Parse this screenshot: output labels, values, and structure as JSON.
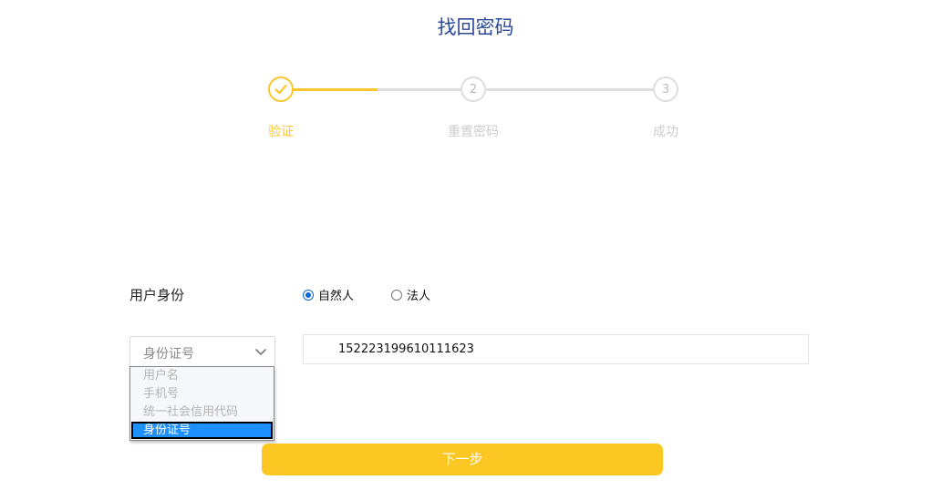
{
  "page": {
    "title": "找回密码"
  },
  "steps": [
    {
      "number": "1",
      "label": "验证",
      "status": "done"
    },
    {
      "number": "2",
      "label": "重置密码",
      "status": "pending"
    },
    {
      "number": "3",
      "label": "成功",
      "status": "pending"
    }
  ],
  "form": {
    "identity_label": "用户身份",
    "radio_options": [
      {
        "label": "自然人",
        "checked": true
      },
      {
        "label": "法人",
        "checked": false
      }
    ],
    "id_type_select": {
      "value": "身份证号",
      "options": [
        "用户名",
        "手机号",
        "统一社会信用代码",
        "身份证号"
      ],
      "selected_index": 3
    },
    "id_input": {
      "value": "152223199610111623"
    },
    "next_button_label": "下一步"
  },
  "colors": {
    "accent": "#fcc723",
    "title": "#2c4a9a",
    "inactive": "#dddddd",
    "radio": "#0a66d8",
    "dropdown_selected": "#1e90ff"
  }
}
